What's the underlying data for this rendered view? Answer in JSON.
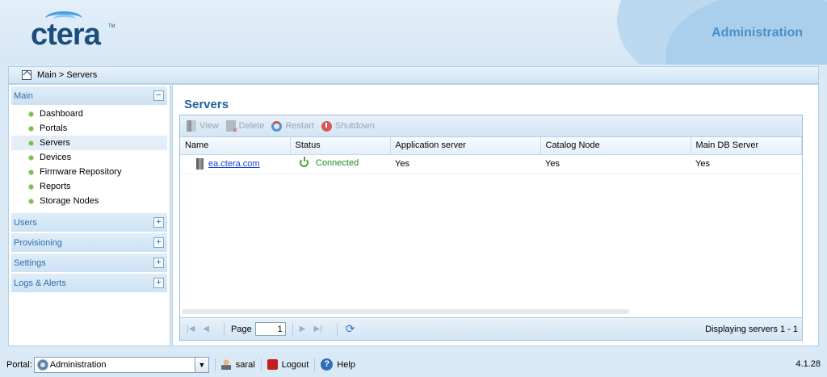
{
  "header": {
    "logo_text": "ctera",
    "logo_tm": "TM",
    "section_title": "Administration"
  },
  "breadcrumb": {
    "text": "Main > Servers"
  },
  "sidebar": {
    "sections": [
      {
        "label": "Main",
        "toggle": "−",
        "items": [
          {
            "label": "Dashboard"
          },
          {
            "label": "Portals"
          },
          {
            "label": "Servers",
            "active": true
          },
          {
            "label": "Devices"
          },
          {
            "label": "Firmware Repository"
          },
          {
            "label": "Reports"
          },
          {
            "label": "Storage Nodes"
          }
        ]
      },
      {
        "label": "Users",
        "toggle": "+"
      },
      {
        "label": "Provisioning",
        "toggle": "+"
      },
      {
        "label": "Settings",
        "toggle": "+"
      },
      {
        "label": "Logs & Alerts",
        "toggle": "+"
      }
    ]
  },
  "main": {
    "title": "Servers",
    "toolbar": {
      "view": "View",
      "delete": "Delete",
      "restart": "Restart",
      "shutdown": "Shutdown"
    },
    "columns": [
      "Name",
      "Status",
      "Application server",
      "Catalog Node",
      "Main DB Server"
    ],
    "rows": [
      {
        "name": "ea.ctera.com",
        "status": "Connected",
        "app_server": "Yes",
        "catalog_node": "Yes",
        "main_db": "Yes"
      }
    ],
    "pager": {
      "page_label": "Page",
      "page_value": "1",
      "info": "Displaying servers 1 - 1"
    }
  },
  "footer": {
    "portal_label": "Portal:",
    "portal_value": "Administration",
    "user": "saral",
    "logout": "Logout",
    "help": "Help",
    "version": "4.1.28"
  },
  "colors": {
    "accent": "#1f5f9e",
    "status_ok": "#1f8a1f",
    "link": "#1a3fd0"
  }
}
